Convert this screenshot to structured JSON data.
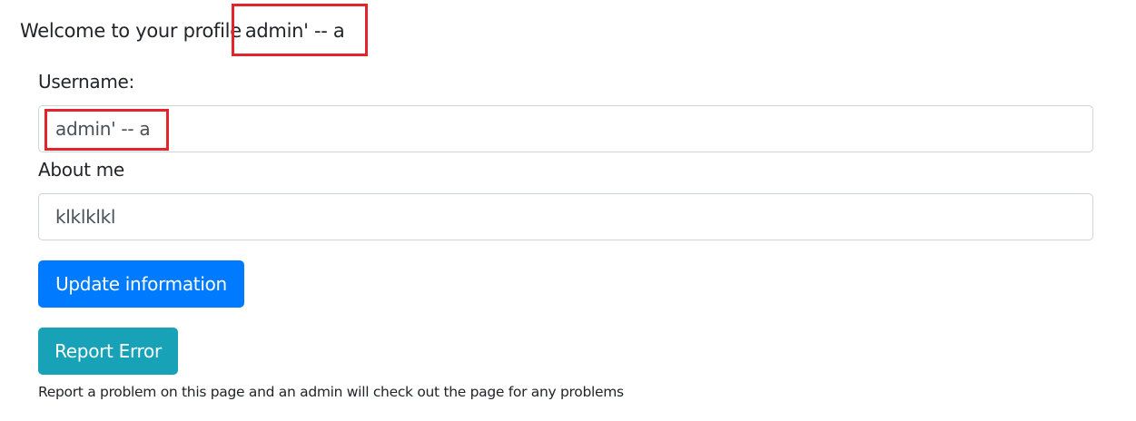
{
  "profile": {
    "welcome_text": "Welcome to your profile",
    "username_display": "admin' -- a"
  },
  "form": {
    "username_label": "Username:",
    "username_value": "admin' -- a",
    "about_label": "About me",
    "about_value": "klklklkl",
    "update_button": "Update information"
  },
  "report": {
    "button_label": "Report Error",
    "note": "Report a problem on this page and an admin will check out the page for any problems"
  },
  "colors": {
    "primary": "#007bff",
    "info": "#17a2b8",
    "highlight": "#e3242b"
  }
}
